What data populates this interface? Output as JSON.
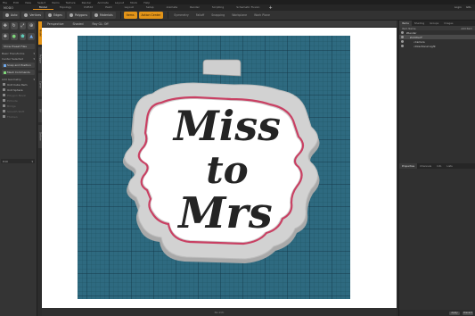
{
  "menubar": {
    "items": [
      "File",
      "Edit",
      "View",
      "Select",
      "Items",
      "Texture",
      "Render",
      "Animate",
      "Layout",
      "Modo",
      "Help"
    ]
  },
  "titlebar": {
    "app_name": "MODO",
    "tabs": [
      {
        "label": "Model",
        "active": true
      },
      {
        "label": "Topology",
        "active": false
      },
      {
        "label": "UVEdit",
        "active": false
      },
      {
        "label": "Paint",
        "active": false
      },
      {
        "label": "Layout",
        "active": false
      },
      {
        "label": "Setup",
        "active": false
      },
      {
        "label": "Animate",
        "active": false
      },
      {
        "label": "Render",
        "active": false
      },
      {
        "label": "Scripting",
        "active": false
      },
      {
        "label": "Schematic Fusion",
        "active": false
      }
    ],
    "right_items": [
      "Login",
      "GRL"
    ]
  },
  "toolbar": {
    "items": [
      {
        "label": "Auto",
        "style": "dark"
      },
      {
        "label": "Vertices",
        "style": "dark"
      },
      {
        "label": "Edges",
        "style": "dark"
      },
      {
        "label": "Polygons",
        "style": "dark"
      },
      {
        "label": "Materials",
        "style": "dark"
      },
      {
        "label": "Items",
        "style": "orange"
      },
      {
        "label": "Action Center",
        "style": "orange"
      },
      {
        "label": "Symmetry",
        "style": "flat"
      },
      {
        "label": "Falloff",
        "style": "flat"
      },
      {
        "label": "Snapping",
        "style": "flat"
      },
      {
        "label": "Workplane",
        "style": "flat"
      },
      {
        "label": "Work Plane",
        "style": "flat"
      }
    ]
  },
  "leftpanel": {
    "button_new_mesh": "Show Preset Files",
    "head_transforms": "Basic Transforms",
    "head_selection": "Center Selected",
    "btn_snap": "Snap and Position",
    "btn_commands": "Mesh Commands",
    "head_edit": "Add Geometry",
    "items": [
      "Unit Cube Item",
      "Unit Sphere",
      "Polygon Bevel",
      "Extrude",
      "Bridge",
      "Smooth Shift",
      "Thicken"
    ],
    "dropdown_value": "Edit",
    "vertical_tabs": [
      "Model",
      "Polygon",
      "Curve",
      "UV",
      "Deform"
    ]
  },
  "viewport": {
    "header_items": [
      "Perspective",
      "Shaded",
      "Ray GL: Off"
    ],
    "design_text": [
      "Miss",
      "to",
      "Mrs"
    ],
    "status_text": "No Info"
  },
  "rightpanel": {
    "tabs": [
      "Items",
      "Shading",
      "Groups",
      "Images"
    ],
    "columns": [
      "Item Name",
      "Add Item"
    ],
    "tree": [
      {
        "label": "Render",
        "selected": false
      },
      {
        "label": "Untitled*",
        "selected": true
      },
      {
        "label": "Camera",
        "selected": false
      },
      {
        "label": "Directional Light",
        "selected": false
      }
    ],
    "lower_tabs": [
      "Properties",
      "Channels",
      "Info",
      "Lists"
    ],
    "footer_buttons": [
      "Apply",
      "Discard"
    ]
  },
  "colors": {
    "accent": "#e39418",
    "grid_base": "#2e6a80",
    "cutter_outline": "#d1d1d1",
    "inner_edge": "#c94063",
    "design_text": "#242424"
  }
}
